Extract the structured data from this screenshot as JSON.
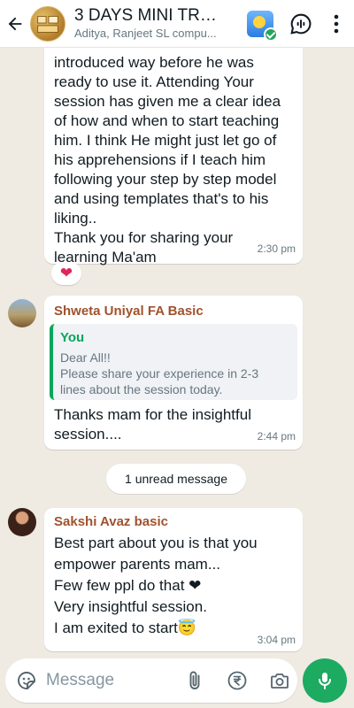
{
  "header": {
    "title": "3 DAYS MINI TRAI...",
    "subtitle": "Aditya, Ranjeet SL compu..."
  },
  "messages": [
    {
      "lines": [
        "introduced way before he was",
        "ready to use it. Attending Your",
        "session has given me a clear idea",
        "of how and when to start teaching",
        "him. I think He might just let go of",
        "his apprehensions if I teach him",
        "following your step by step model",
        "and using templates that's to his",
        "liking..",
        "Thank you for sharing your",
        "learning Ma'am"
      ],
      "time": "2:30 pm",
      "reaction": "❤"
    },
    {
      "sender": "Shweta Uniyal FA Basic",
      "quote_author": "You",
      "quote_lines": [
        "Dear All!!",
        "Please share your experience in 2-3",
        "lines about the session today."
      ],
      "lines": [
        "Thanks mam for the insightful",
        "session...."
      ],
      "time": "2:44 pm"
    },
    {
      "sender": "Sakshi Avaz basic",
      "lines": [
        "Best part about you is that you",
        "empower parents mam...",
        "Few few ppl do that ❤",
        "Very insightful session.",
        "I am exited to start😇"
      ],
      "time": "3:04 pm"
    }
  ],
  "unread_label": "1 unread message",
  "composer": {
    "placeholder": "Message"
  },
  "colors": {
    "accent": "#1daa61",
    "chat_background": "#efeae2",
    "sender_name": "#a0522d",
    "quote_bar": "#06a75b"
  }
}
